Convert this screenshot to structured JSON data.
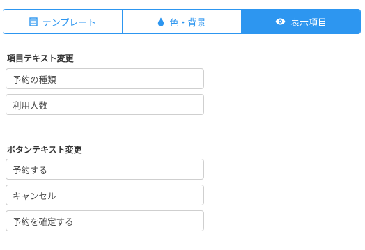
{
  "tabs": [
    {
      "label": "テンプレート",
      "icon": "list-icon",
      "active": false
    },
    {
      "label": "色・背景",
      "icon": "drop-icon",
      "active": false
    },
    {
      "label": "表示項目",
      "icon": "eye-icon",
      "active": true
    }
  ],
  "item_section": {
    "title": "項目テキスト変更",
    "fields": [
      "予約の種類",
      "利用人数"
    ]
  },
  "button_section": {
    "title": "ボタンテキスト変更",
    "fields": [
      "予約する",
      "キャンセル",
      "予約を確定する"
    ]
  },
  "colors": {
    "accent": "#2d96f0",
    "border": "#cfcfcf"
  }
}
